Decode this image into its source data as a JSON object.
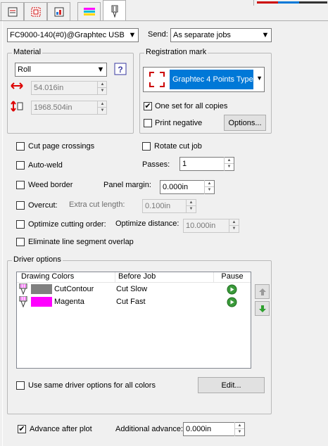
{
  "tabs": [
    {
      "icon": "general-icon"
    },
    {
      "icon": "layout-icon"
    },
    {
      "icon": "image-icon"
    },
    {
      "icon": "color-icon"
    },
    {
      "icon": "cutter-icon"
    }
  ],
  "device": {
    "value": "FC9000-140(#0)@Graphtec USB"
  },
  "send": {
    "label": "Send:",
    "value": "As separate jobs"
  },
  "material": {
    "group_label": "Material",
    "value": "Roll",
    "width": "54.016in",
    "length": "1968.504in"
  },
  "registration": {
    "group_label": "Registration mark",
    "type_value": "Graphtec 4 Points Type",
    "one_set_label": "One set for all copies",
    "one_set_checked": true,
    "print_negative_label": "Print negative",
    "print_negative_checked": false,
    "options_button": "Options..."
  },
  "options": {
    "cut_page_crossings": "Cut page crossings",
    "rotate_cut_job": "Rotate cut job",
    "auto_weld": "Auto-weld",
    "passes_label": "Passes:",
    "passes_value": "1",
    "weed_border": "Weed border",
    "panel_margin_label": "Panel margin:",
    "panel_margin_value": "0.000in",
    "overcut": "Overcut:",
    "extra_cut_length_label": "Extra cut length:",
    "extra_cut_length_value": "0.100in",
    "optimize_cutting_order": "Optimize cutting order:",
    "optimize_distance_label": "Optimize distance:",
    "optimize_distance_value": "10.000in",
    "eliminate_overlap": "Eliminate line segment overlap"
  },
  "driver_options": {
    "group_label": "Driver options",
    "columns": [
      "Drawing Colors",
      "Before Job",
      "Pause"
    ],
    "rows": [
      {
        "color_name": "CutContour",
        "swatch": "#808080",
        "before_job": "Cut Slow"
      },
      {
        "color_name": "Magenta",
        "swatch": "#ff00ff",
        "before_job": "Cut Fast"
      }
    ],
    "same_options_label": "Use same driver options for all colors",
    "edit_button": "Edit..."
  },
  "advance": {
    "advance_label": "Advance after plot",
    "advance_checked": true,
    "additional_label": "Additional advance:",
    "additional_value": "0.000in"
  },
  "colors": {
    "accent": "#0078d7",
    "pause_green": "#3a9a3a"
  }
}
